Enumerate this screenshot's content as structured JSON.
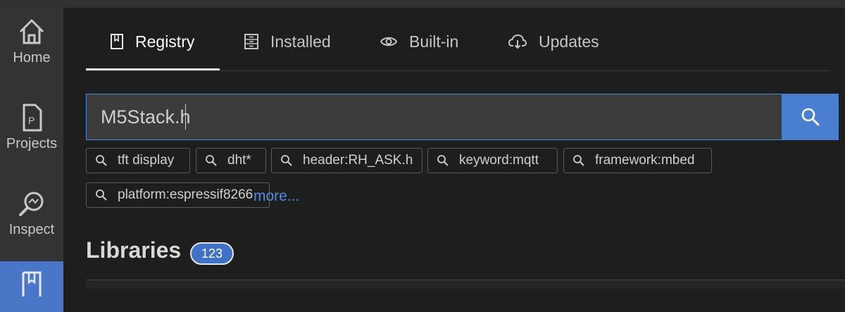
{
  "sidebar": {
    "items": [
      {
        "label": "Home",
        "icon": "home-icon"
      },
      {
        "label": "Projects",
        "icon": "projects-icon"
      },
      {
        "label": "Inspect",
        "icon": "inspect-icon"
      },
      {
        "label": "",
        "icon": "libraries-icon",
        "active": true
      }
    ]
  },
  "tabs": [
    {
      "label": "Registry",
      "icon": "book-icon",
      "active": true
    },
    {
      "label": "Installed",
      "icon": "cabinet-icon"
    },
    {
      "label": "Built-in",
      "icon": "eye-icon"
    },
    {
      "label": "Updates",
      "icon": "cloud-download-icon"
    }
  ],
  "search": {
    "value": "M5Stack.h"
  },
  "suggestions": [
    "tft display",
    "dht*",
    "header:RH_ASK.h",
    "keyword:mqtt",
    "framework:mbed",
    "platform:espressif8266"
  ],
  "more_label": "more...",
  "libraries": {
    "title": "Libraries",
    "count": "123"
  },
  "colors": {
    "accent": "#4a7fd0",
    "link": "#4e8ee0",
    "sidebar": "#333333",
    "background": "#1e1e1e"
  }
}
